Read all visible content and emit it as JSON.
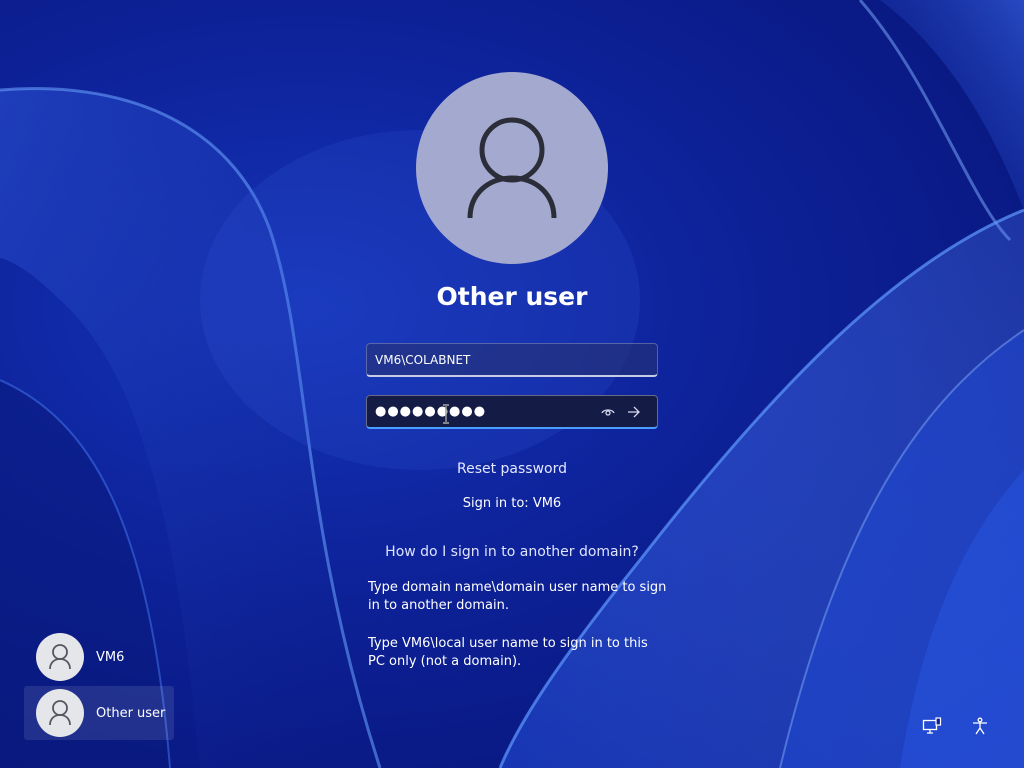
{
  "user": {
    "title": "Other user"
  },
  "username_field": {
    "value": "VM6\\COLABNET"
  },
  "password_field": {
    "masked_value": "●●●●●●●●●",
    "reveal_icon": "eye-icon",
    "submit_icon": "arrow-right-icon"
  },
  "links": {
    "reset_password": "Reset password",
    "domain_question": "How do I sign in to another domain?"
  },
  "sign_in_to": "Sign in to: VM6",
  "help": {
    "line1": "Type domain name\\domain user name to sign in to another domain.",
    "line2": "Type VM6\\local user name to sign in to this PC only (not a domain)."
  },
  "user_tiles": [
    {
      "label": "VM6",
      "selected": false
    },
    {
      "label": "Other user",
      "selected": true
    }
  ],
  "corner_icons": {
    "network": "network-icon",
    "accessibility": "accessibility-icon"
  },
  "colors": {
    "background": "#0d2197",
    "avatar": "#a3a9cf",
    "focus_accent": "#4a9eff"
  }
}
